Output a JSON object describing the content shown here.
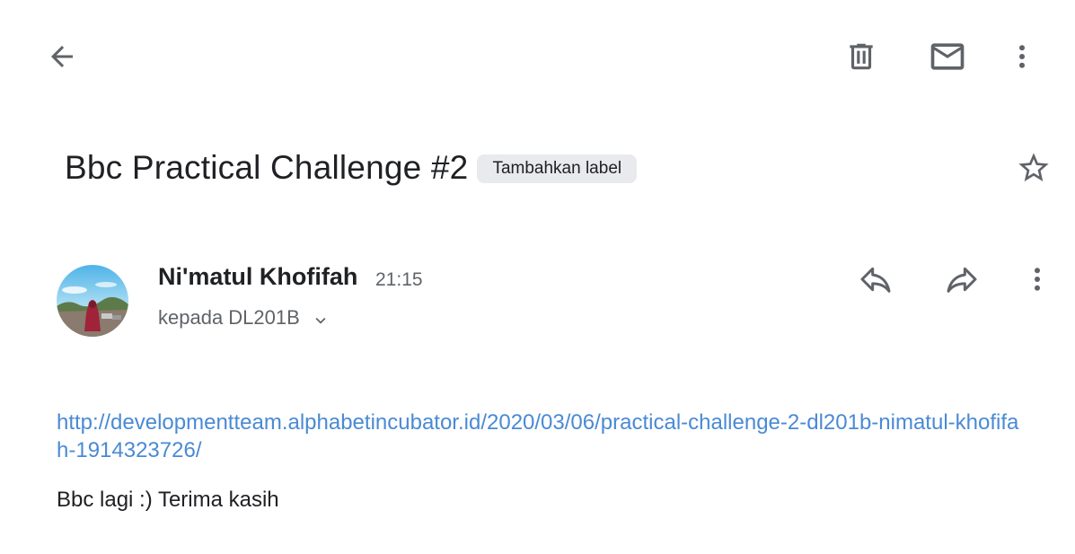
{
  "toolbar": {
    "back_icon": "arrow-back-icon",
    "delete_icon": "trash-icon",
    "mark_unread_icon": "mail-icon",
    "more_icon": "more-vert-icon"
  },
  "message": {
    "subject": "Bbc Practical Challenge #2",
    "label_chip": "Tambahkan label",
    "star_icon": "star-outline-icon",
    "sender_name": "Ni'matul Khofifah",
    "time": "21:15",
    "recipient": "kepada DL201B",
    "reply_icon": "reply-icon",
    "forward_icon": "forward-icon",
    "more_icon": "more-vert-icon",
    "body_link": "http://developmentteam.alphabetincubator.id/2020/03/06/practical-challenge-2-dl201b-nimatul-khofifah-1914323726/",
    "body_text": "Bbc lagi :) Terima kasih"
  },
  "colors": {
    "icon": "#5f6368",
    "link": "#4a8ad4",
    "chip_bg": "#e8eaed",
    "text": "#202124"
  }
}
